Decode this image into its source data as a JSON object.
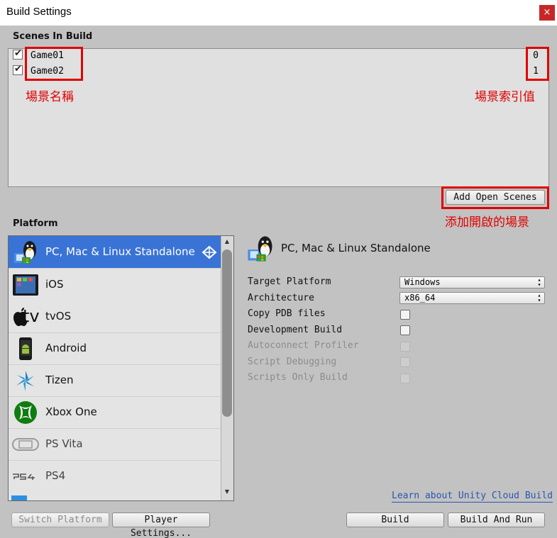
{
  "window": {
    "title": "Build Settings",
    "close_glyph": "×"
  },
  "scenes": {
    "section_label": "Scenes In Build",
    "items": [
      {
        "name": "Game01",
        "index": "0",
        "checked": true
      },
      {
        "name": "Game02",
        "index": "1",
        "checked": true
      }
    ],
    "add_open_scenes_label": "Add Open Scenes"
  },
  "annotations": {
    "scene_name": "場景名稱",
    "scene_index": "場景索引值",
    "add_open_scenes": "添加開啟的場景",
    "color": "#e00000"
  },
  "platform": {
    "section_label": "Platform",
    "items": [
      {
        "label": "PC, Mac & Linux Standalone",
        "icon": "pc-standalone-icon",
        "selected": true
      },
      {
        "label": "iOS",
        "icon": "ipad-icon"
      },
      {
        "label": "tvOS",
        "icon": "apple-tv-icon"
      },
      {
        "label": "Android",
        "icon": "android-phone-icon"
      },
      {
        "label": "Tizen",
        "icon": "tizen-icon"
      },
      {
        "label": "Xbox One",
        "icon": "xbox-icon"
      },
      {
        "label": "PS Vita",
        "icon": "ps-vita-icon"
      },
      {
        "label": "PS4",
        "icon": "ps4-logo"
      }
    ],
    "selected_color": "#3a73d6"
  },
  "settings": {
    "heading": "PC, Mac & Linux Standalone",
    "target_platform": {
      "label": "Target Platform",
      "value": "Windows"
    },
    "architecture": {
      "label": "Architecture",
      "value": "x86_64"
    },
    "checkboxes": [
      {
        "label": "Copy PDB files",
        "enabled": true,
        "checked": false
      },
      {
        "label": "Development Build",
        "enabled": true,
        "checked": false
      },
      {
        "label": "Autoconnect Profiler",
        "enabled": false,
        "checked": false
      },
      {
        "label": "Script Debugging",
        "enabled": false,
        "checked": false
      },
      {
        "label": "Scripts Only Build",
        "enabled": false,
        "checked": false
      }
    ],
    "learn_link": "Learn about Unity Cloud Build"
  },
  "footer": {
    "switch_platform": "Switch Platform",
    "player_settings": "Player Settings...",
    "build": "Build",
    "build_and_run": "Build And Run"
  }
}
